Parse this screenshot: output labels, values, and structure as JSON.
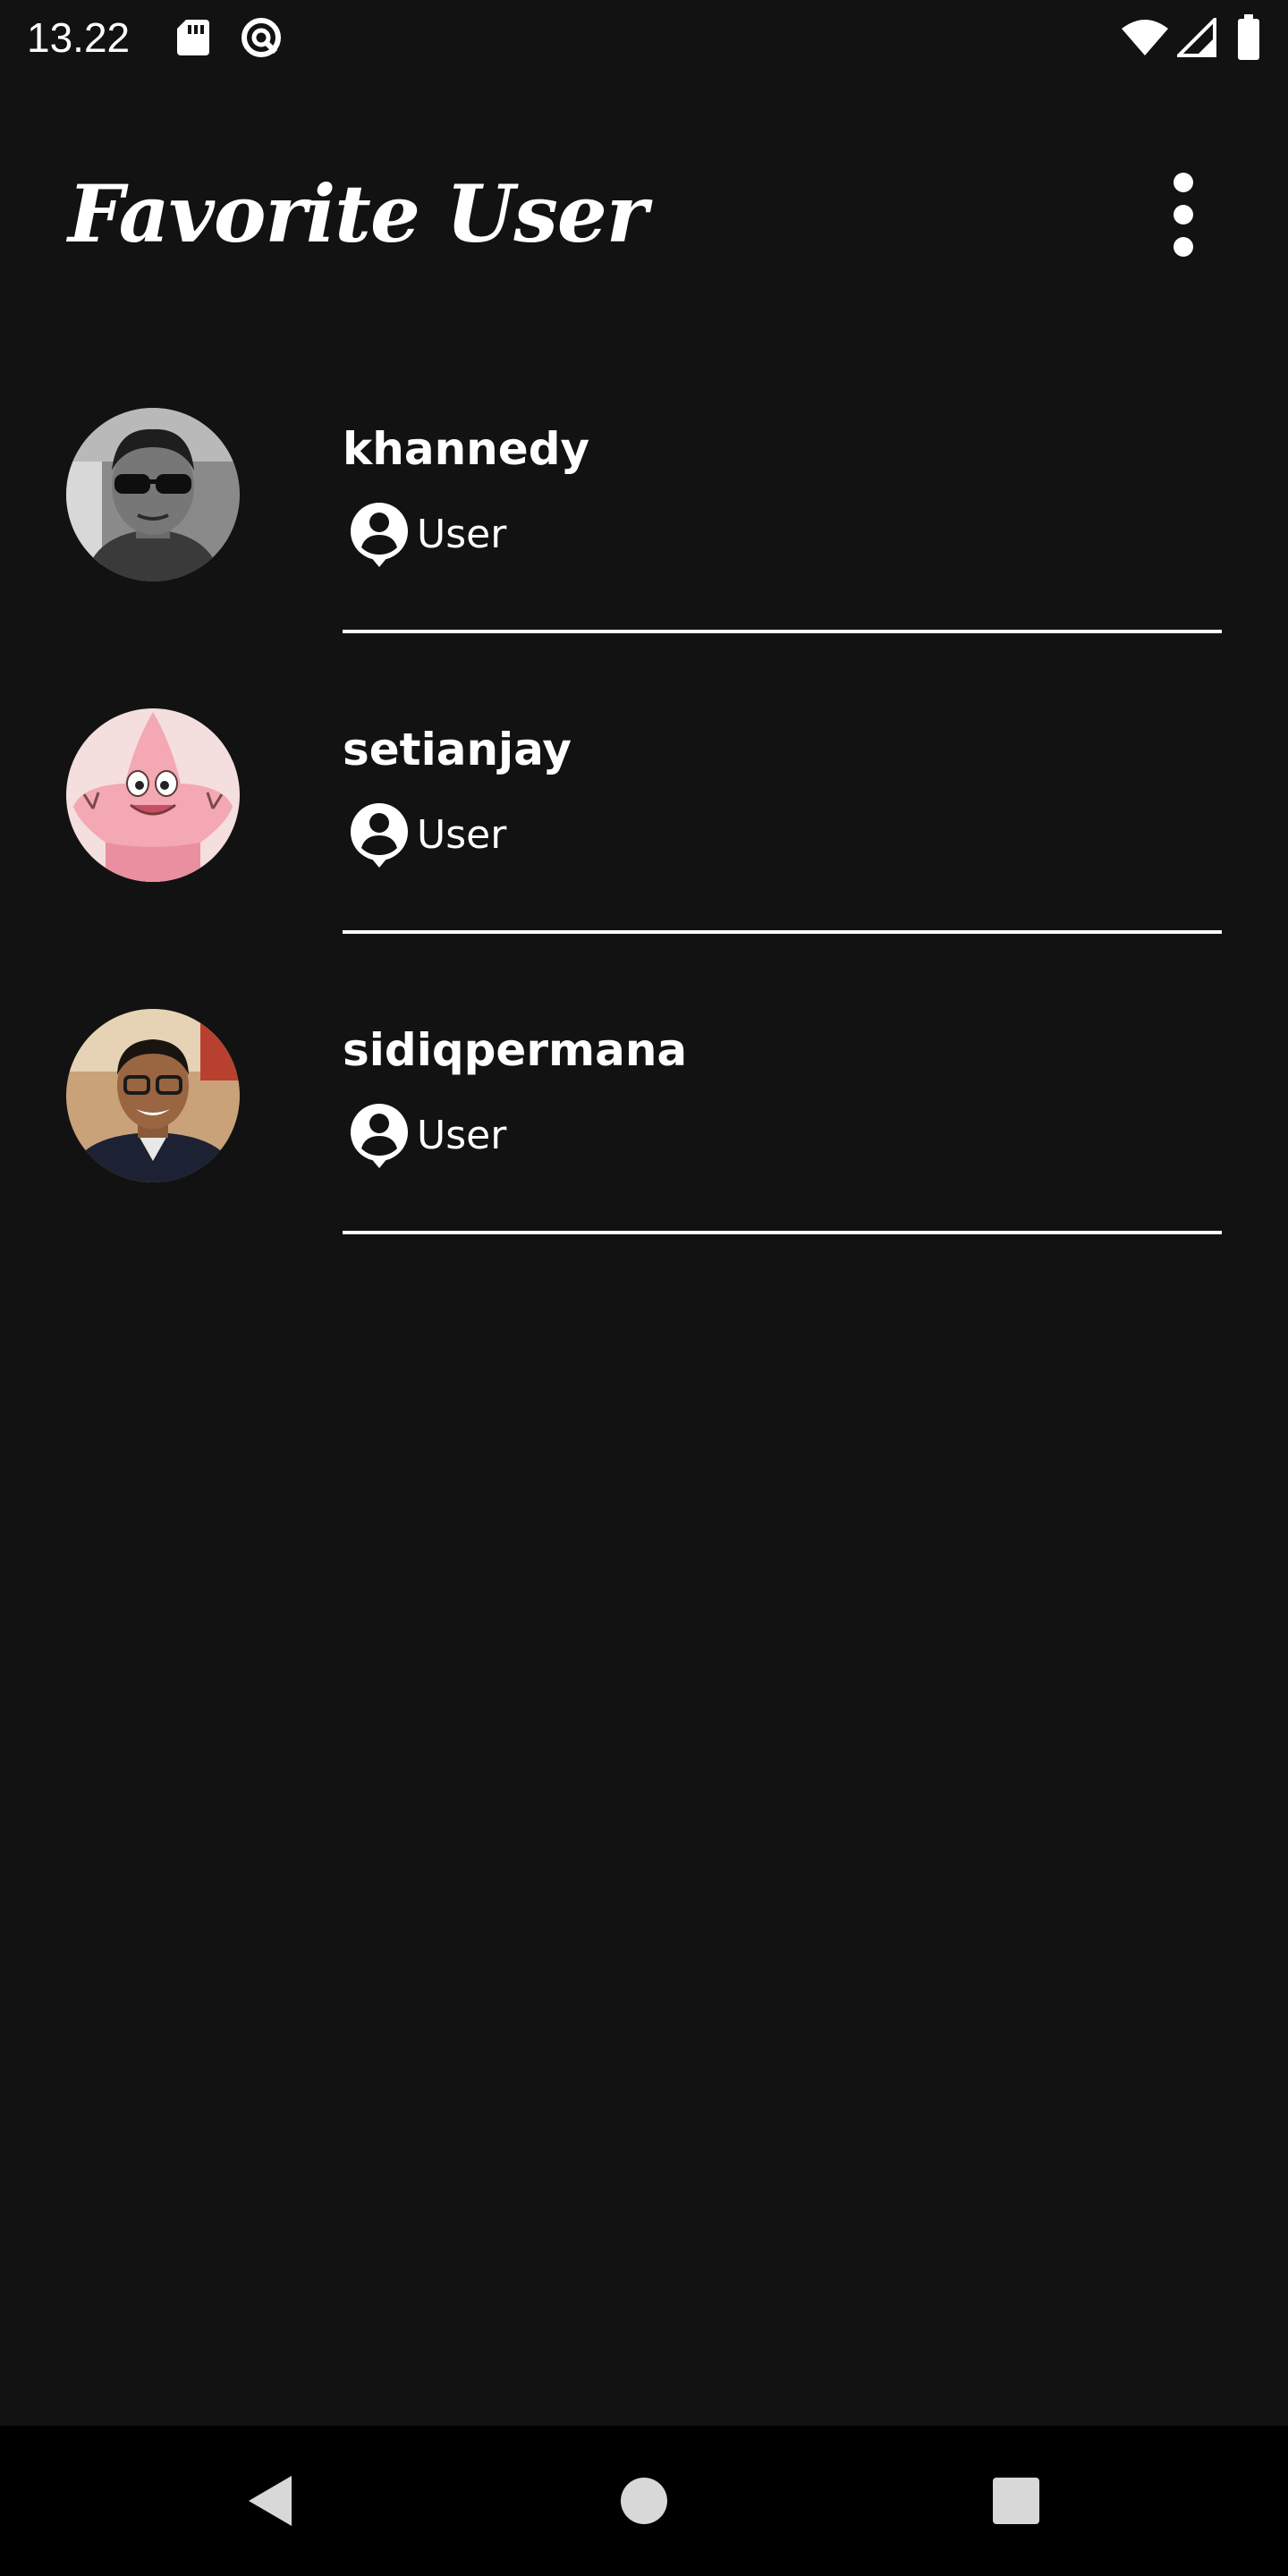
{
  "status_bar": {
    "time": "13.22",
    "icons": [
      "sdcard-icon",
      "sync-icon",
      "wifi-icon",
      "signal-icon",
      "battery-icon"
    ]
  },
  "app_bar": {
    "title": "Favorite User",
    "menu_icon": "more-vert-icon"
  },
  "users": [
    {
      "username": "khannedy",
      "type": "User",
      "avatar": "avatar-photo-sunglasses"
    },
    {
      "username": "setianjay",
      "type": "User",
      "avatar": "avatar-cartoon-starfish"
    },
    {
      "username": "sidiqpermana",
      "type": "User",
      "avatar": "avatar-photo-glasses"
    }
  ],
  "nav_bar": {
    "icons": [
      "back-icon",
      "home-icon",
      "recents-icon"
    ]
  },
  "colors": {
    "background": "#121212",
    "text": "#ffffff",
    "nav_bar": "#000000"
  }
}
